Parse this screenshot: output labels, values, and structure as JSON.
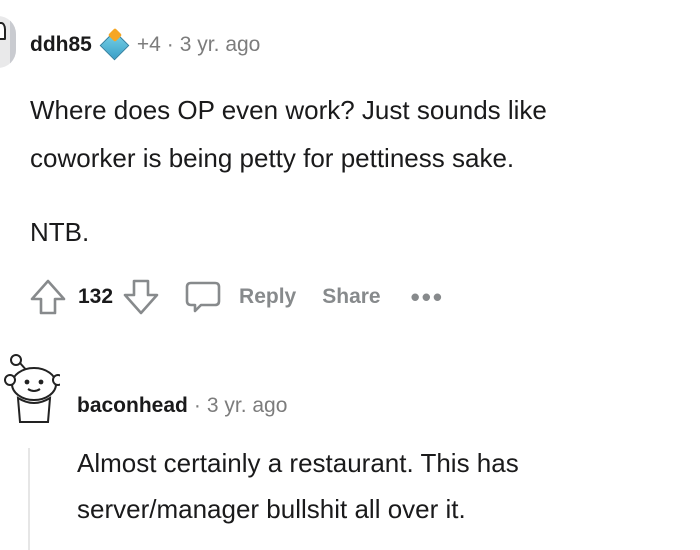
{
  "comment1": {
    "username": "ddh85",
    "flair_icon": "diamond-flair-icon",
    "score_change": "+4",
    "separator": "·",
    "age": "3 yr. ago",
    "lines": [
      "Where does OP even work? Just sounds like",
      "coworker is being petty for pettiness sake."
    ],
    "line2": "NTB.",
    "vote_count": "132",
    "reply_label": "Reply",
    "share_label": "Share",
    "more_label": "•••"
  },
  "comment2": {
    "username": "baconhead",
    "separator": "·",
    "age": "3 yr. ago",
    "lines": [
      "Almost certainly a restaurant. This has",
      "server/manager bullshit all over it."
    ]
  },
  "colors": {
    "text": "#1a1a1b",
    "muted": "#7c7c7c",
    "action_gray": "#878a8c",
    "thread_line": "#e6e6e6"
  }
}
